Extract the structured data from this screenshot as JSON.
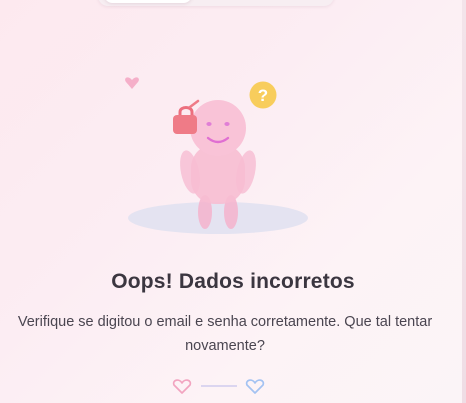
{
  "error": {
    "title": "Oops! Dados incorretos",
    "message": "Verifique se digitou o email e senha corretamente. Que tal tentar novamente?"
  },
  "illustration": {
    "question_mark": "?",
    "icons": [
      "heart-icon",
      "lock-icon",
      "question-mark-icon"
    ]
  },
  "colors": {
    "background": "#fdeef3",
    "figure_pink": "#f7b9d0",
    "lock": "#ee7a86",
    "question_badge": "#f7cd5e",
    "shadow": "#dcdcee",
    "heart_pink": "#f2a7c1",
    "heart_blue": "#a9c8f3"
  }
}
